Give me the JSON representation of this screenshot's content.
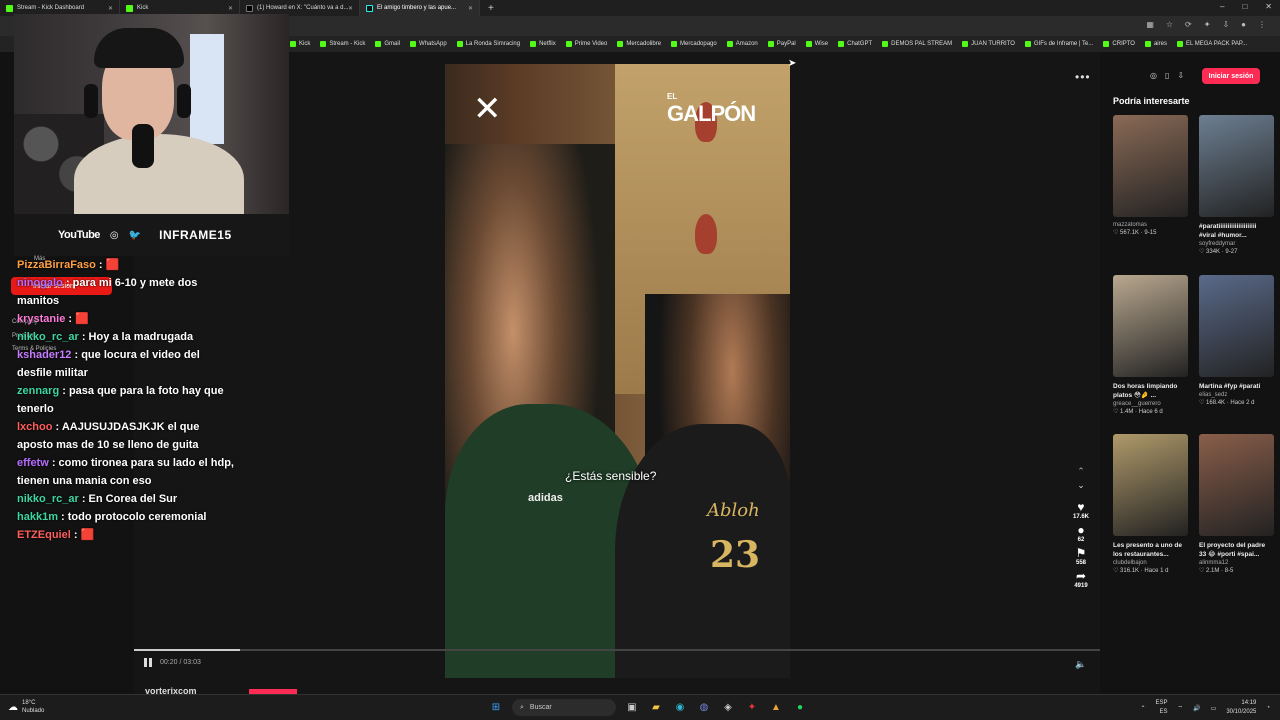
{
  "browser": {
    "tabs": [
      {
        "label": "Stream - Kick Dashboard",
        "active": false,
        "icon": "kick-icon"
      },
      {
        "label": "Kick",
        "active": false,
        "icon": "kick-icon"
      },
      {
        "label": "(1) Howard en X: \"Cuánto va a d...",
        "active": false,
        "icon": "x-icon"
      },
      {
        "label": "El amigo timbero y las apue...",
        "active": true,
        "icon": "tiktok-icon"
      }
    ],
    "new_tab": "+",
    "window_controls": {
      "minimize": "–",
      "maximize": "□",
      "close": "✕"
    }
  },
  "bookmarks": [
    "Kick",
    "Stream - Kick",
    "Gmail",
    "WhatsApp",
    "La Ronda Simracing",
    "Netflix",
    "Prime Video",
    "Mercadolibre",
    "Mercadopago",
    "Amazon",
    "PayPal",
    "Wise",
    "ChatGPT",
    "DEMOS PAL STREAM",
    "JUAN TURRITO",
    "GIFs de Inframe | Te...",
    "CRIPTO",
    "aires",
    "EL MEGA PACK PAP..."
  ],
  "video": {
    "subtitle": "¿Estás sensible?",
    "brand": "GALPÓN",
    "brand_prefix": "EL",
    "x_logo": "✕",
    "shirt_text": "Abloh",
    "shirt_number": "23",
    "shirt_brand": "adidas",
    "time": "00:20 / 03:03",
    "progress": 0.11,
    "channel": "vorterixcom",
    "actions": [
      {
        "name": "like",
        "icon": "♥",
        "count": "17.6K"
      },
      {
        "name": "comment",
        "icon": "●",
        "count": "62"
      },
      {
        "name": "save",
        "icon": "⚑",
        "count": "558"
      },
      {
        "name": "share",
        "icon": "➦",
        "count": "4919"
      }
    ],
    "nav_up": "⌃",
    "nav_down": "⌄",
    "more": "•••",
    "volume_icon": "🔈"
  },
  "sidebar": {
    "login_label": "Iniciar sesión",
    "heading": "Podría interesarte",
    "cards": [
      {
        "title": "",
        "author": "mazzatomas",
        "meta": "♡ 567.1K · 9-15",
        "color": "#8a6a56"
      },
      {
        "title": "#paratiiiiiiiiiiiiiiiiiiiii #viral #humor...",
        "author": "soyfreddymar",
        "meta": "♡ 334K · 9-27",
        "color": "#6d7f92"
      },
      {
        "title": "Dos horas limpiando platos 😳🤌 ...",
        "author": "greace__guerrero",
        "meta": "♡ 1.4M · Hace 6 d",
        "color": "#b9a88f"
      },
      {
        "title": "Martina #fyp #parati",
        "author": "elias_sedz",
        "meta": "♡ 168.4K · Hace 2 d",
        "color": "#5a6a8a"
      },
      {
        "title": "Les presento a uno de los restaurantes...",
        "author": "clubdelbajon",
        "meta": "♡ 316.1K · Hace 1 d",
        "color": "#b09a6a"
      },
      {
        "title": "El proyecto del padre 33 😂 #porti #spai...",
        "author": "alinmma12",
        "meta": "♡ 2.1M · 8-5",
        "color": "#8a5e4a"
      }
    ]
  },
  "stream": {
    "socials": {
      "youtube": "YouTube",
      "instagram": "◎",
      "twitter": "🐦",
      "handle": "INFRAME15"
    },
    "chat": [
      {
        "user": "PizzaBirraFaso",
        "text": " : 🟥",
        "color": "#ff9f43"
      },
      {
        "user": "ninogalo",
        "text": " : para mi 6-10 y mete dos manitos",
        "color": "#b66dff"
      },
      {
        "user": "krystanie",
        "text": " : 🟥",
        "color": "#ff7ad9"
      },
      {
        "user": "nikko_rc_ar",
        "text": " : Hoy a la madrugada",
        "color": "#3cd6a0"
      },
      {
        "user": "kshader12",
        "text": " : que locura el video del desfile militar",
        "color": "#c77dff"
      },
      {
        "user": "zennarg",
        "text": " : pasa que para la foto hay que tenerlo",
        "color": "#3cd6a0"
      },
      {
        "user": "lxchoo",
        "text": " : AAJUSUJDASJKJK el que aposto mas de 10 se lleno de guita",
        "color": "#ff5c5c"
      },
      {
        "user": "effetw",
        "text": " : como tironea para su lado el hdp, tienen una mania con eso",
        "color": "#b66dff"
      },
      {
        "user": "nikko_rc_ar",
        "text": " : En Corea del Sur",
        "color": "#3cd6a0"
      },
      {
        "user": "hakk1m",
        "text": " : todo protocolo ceremonial",
        "color": "#3cd6a0"
      },
      {
        "user": "ETZEquiel",
        "text": " : 🟥",
        "color": "#ff5c5c"
      }
    ],
    "overlay_texts": [
      "Más",
      "Iniciar sesión",
      "Terms & Policies",
      "Company",
      "Program"
    ]
  },
  "taskbar": {
    "weather_temp": "18°C",
    "weather_desc": "Nublado",
    "search_placeholder": "Buscar",
    "lang": "ESP",
    "lang_sub": "ES",
    "time": "14:19",
    "date": "30/10/2025"
  }
}
